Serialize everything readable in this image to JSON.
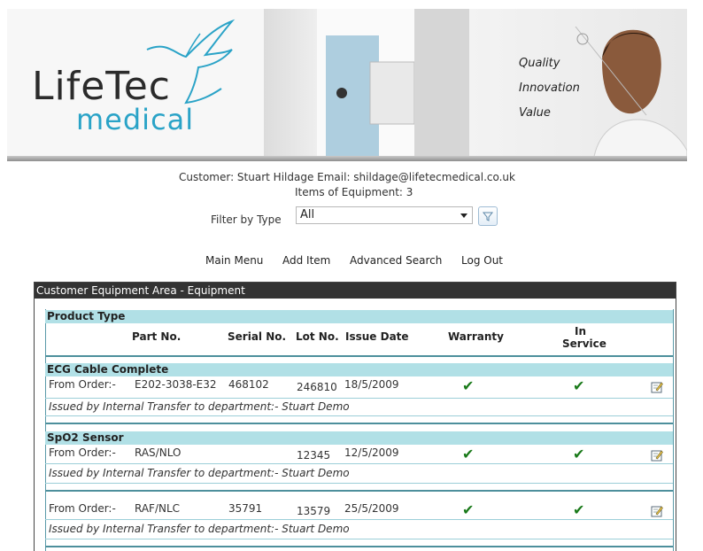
{
  "banner": {
    "logo_line1": "LifeTec",
    "logo_line2": "medical",
    "tagline": [
      "Quality",
      "Innovation",
      "Value"
    ]
  },
  "customer": {
    "line": "Customer: Stuart Hildage   Email: shildage@lifetecmedical.co.uk",
    "items": "Items of Equipment: 3"
  },
  "filter": {
    "label": "Filter by Type",
    "selected": "All",
    "button_icon": "funnel-icon"
  },
  "nav": {
    "main_menu": "Main Menu",
    "add_item": "Add Item",
    "advanced_search": "Advanced Search",
    "log_out": "Log Out"
  },
  "panel": {
    "title": "Customer Equipment Area - Equipment",
    "columns": {
      "product_type": "Product Type",
      "part_no": "Part No.",
      "serial_no": "Serial No.",
      "lot_no": "Lot No.",
      "issue_date": "Issue Date",
      "warranty": "Warranty",
      "in_service_1": "In",
      "in_service_2": "Service"
    },
    "items": [
      {
        "product_type": "ECG Cable Complete",
        "from_order": "From Order:-",
        "part_no": "E202-3038-E32",
        "serial_no": "468102",
        "lot_no": "246810",
        "issue_date": "18/5/2009",
        "warranty": true,
        "in_service": true,
        "issued": "Issued by Internal Transfer to department:- Stuart Demo"
      },
      {
        "product_type": "SpO2 Sensor",
        "from_order": "From Order:-",
        "part_no": "RAS/NLO",
        "serial_no": "",
        "lot_no": "12345",
        "issue_date": "12/5/2009",
        "warranty": true,
        "in_service": true,
        "issued": "Issued by Internal Transfer to department:- Stuart Demo"
      },
      {
        "product_type": "",
        "from_order": "From Order:-",
        "part_no": "RAF/NLC",
        "serial_no": "35791",
        "lot_no": "13579",
        "issue_date": "25/5/2009",
        "warranty": true,
        "in_service": true,
        "issued": "Issued by Internal Transfer to department:- Stuart Demo"
      }
    ],
    "check_glyph": "✔",
    "colors": {
      "band": "#b1e0e6",
      "rule": "#4d8f9c",
      "title_bar": "#333333",
      "check": "#1a7a1a",
      "logo_blue": "#2aa3c7"
    }
  }
}
